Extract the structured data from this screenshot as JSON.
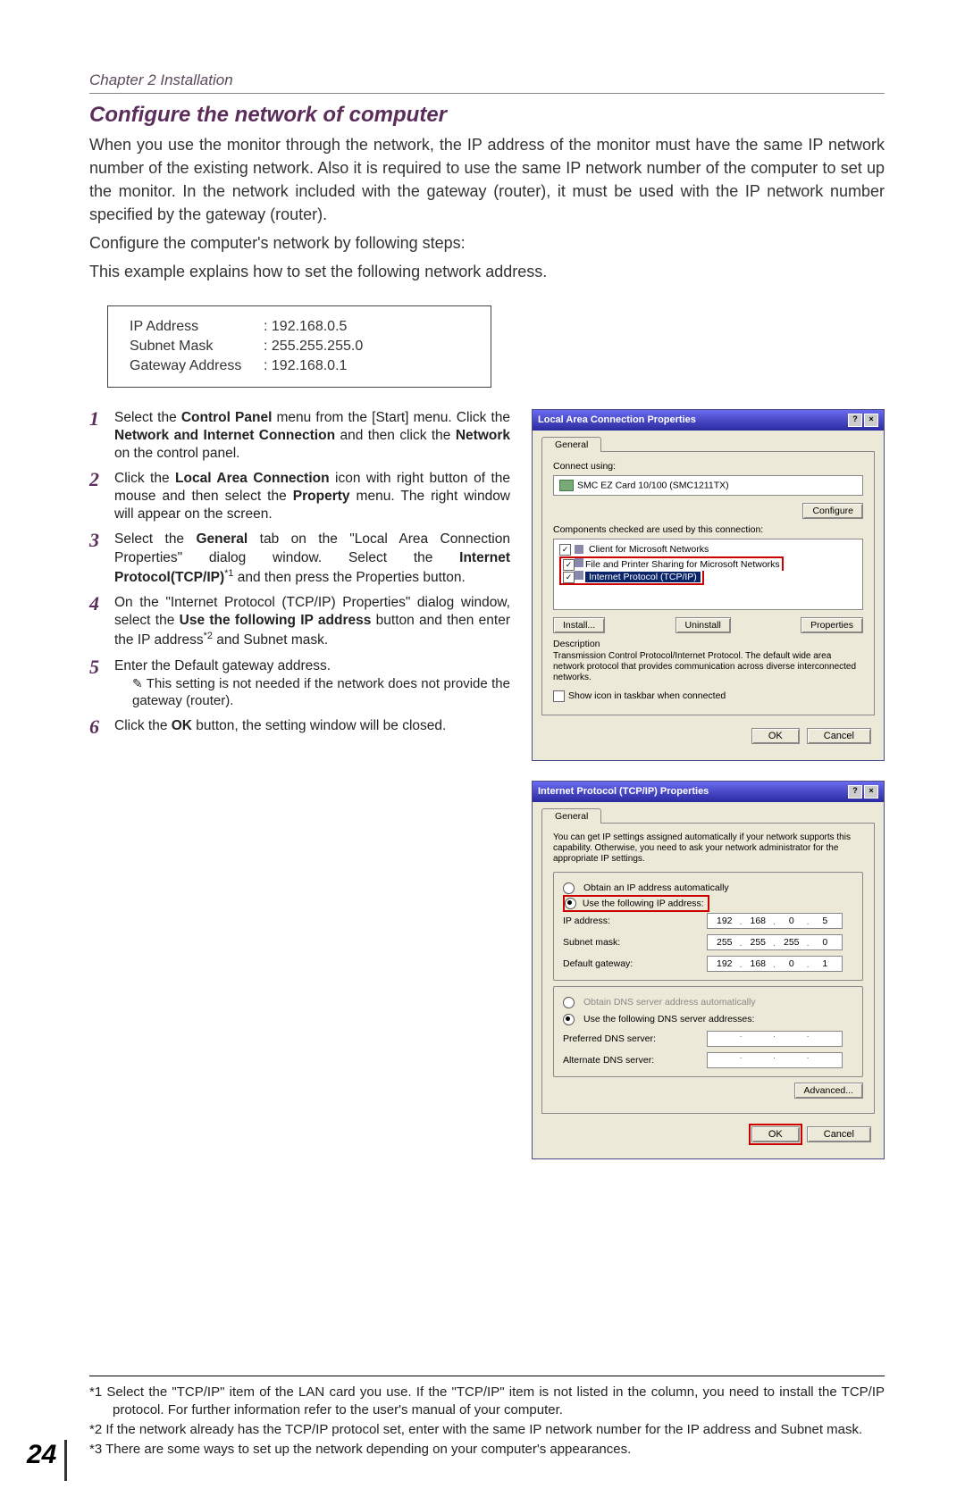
{
  "header": {
    "chapter": "Chapter 2 Installation"
  },
  "section": {
    "title": "Configure the network of computer"
  },
  "intro": {
    "p1": "When you use the monitor through the network, the IP address of the monitor must have the same IP network number of the existing network. Also it is required to use the same IP network number of the computer to set up the monitor. In the network included with the gateway (router), it must be used with the IP network number specified by the gateway (router).",
    "p2": "Configure the computer's network by following steps:",
    "p3": "This example explains how to set the following network address."
  },
  "addr": {
    "rows": [
      {
        "label": "IP Address",
        "value": ": 192.168.0.5"
      },
      {
        "label": "Subnet Mask",
        "value": ": 255.255.255.0"
      },
      {
        "label": "Gateway Address",
        "value": ": 192.168.0.1"
      }
    ]
  },
  "steps": {
    "s1": {
      "num": "1",
      "a": "Select the ",
      "b1": "Control Panel",
      "b": " menu from the [Start] menu. Click the ",
      "b2": "Network and Internet Connection",
      "c": " and then click the ",
      "b3": "Network",
      "d": " on the control panel."
    },
    "s2": {
      "num": "2",
      "a": "Click the ",
      "b1": "Local Area Connection",
      "b": " icon with right button of the mouse and then select the ",
      "b2": "Property",
      "c": " menu. The right window will appear on the screen."
    },
    "s3": {
      "num": "3",
      "a": "Select  the  ",
      "b1": "General",
      "b": "  tab  on  the  \"Local  Area  Connection Properties\"  dialog  window.  Select  the  ",
      "b2": "Internet Protocol(TCP/IP)",
      "sup": "*1",
      "c": " and then press the Properties button."
    },
    "s4": {
      "num": "4",
      "a": "On the \"Internet Protocol (TCP/IP) Properties\" dialog window, select the ",
      "b1": "Use the following IP address",
      "b": " button and then enter the IP address",
      "sup": "*2",
      "c": " and Subnet mask."
    },
    "s5": {
      "num": "5",
      "a": "Enter the Default gateway address.",
      "note": "This setting is not needed if the network does not provide the gateway (router)."
    },
    "s6": {
      "num": "6",
      "a": "Click the ",
      "b1": "OK",
      "b": " button, the setting window will be closed."
    }
  },
  "dlg1": {
    "title": "Local Area Connection Properties",
    "tab": "General",
    "connect_label": "Connect using:",
    "adapter": "SMC EZ Card 10/100 (SMC1211TX)",
    "configure": "Configure",
    "comps_label": "Components checked are used by this connection:",
    "comp1": "Client for Microsoft Networks",
    "comp2": "File and Printer Sharing for Microsoft Networks",
    "comp3": "Internet Protocol (TCP/IP)",
    "install": "Install...",
    "uninstall": "Uninstall",
    "properties": "Properties",
    "desc_h": "Description",
    "desc": "Transmission Control Protocol/Internet Protocol. The default wide area network protocol that provides communication across diverse interconnected networks.",
    "show_icon": "Show icon in taskbar when connected",
    "ok": "OK",
    "cancel": "Cancel"
  },
  "dlg2": {
    "title": "Internet Protocol (TCP/IP) Properties",
    "tab": "General",
    "intro": "You can get IP settings assigned automatically if your network supports this capability. Otherwise, you need to ask your network administrator for the appropriate IP settings.",
    "r1": "Obtain an IP address automatically",
    "r2": "Use the following IP address:",
    "ip_l": "IP address:",
    "ip_v": [
      "192",
      "168",
      "0",
      "5"
    ],
    "sm_l": "Subnet mask:",
    "sm_v": [
      "255",
      "255",
      "255",
      "0"
    ],
    "gw_l": "Default gateway:",
    "gw_v": [
      "192",
      "168",
      "0",
      "1"
    ],
    "r3": "Obtain DNS server address automatically",
    "r4": "Use the following DNS server addresses:",
    "pdns": "Preferred DNS server:",
    "adns": "Alternate DNS server:",
    "adv": "Advanced...",
    "ok": "OK",
    "cancel": "Cancel"
  },
  "footnotes": {
    "f1": "*1 Select the \"TCP/IP\" item of the LAN card you use. If the \"TCP/IP\" item is not listed in the column, you need to install the TCP/IP protocol. For further information refer to the user's manual of your computer.",
    "f2": "*2 If the network already has the TCP/IP protocol set, enter with the same IP network number for the IP address and Subnet mask.",
    "f3": "*3 There are some ways to set up the network depending on your computer's appearances."
  },
  "page_number": "24"
}
